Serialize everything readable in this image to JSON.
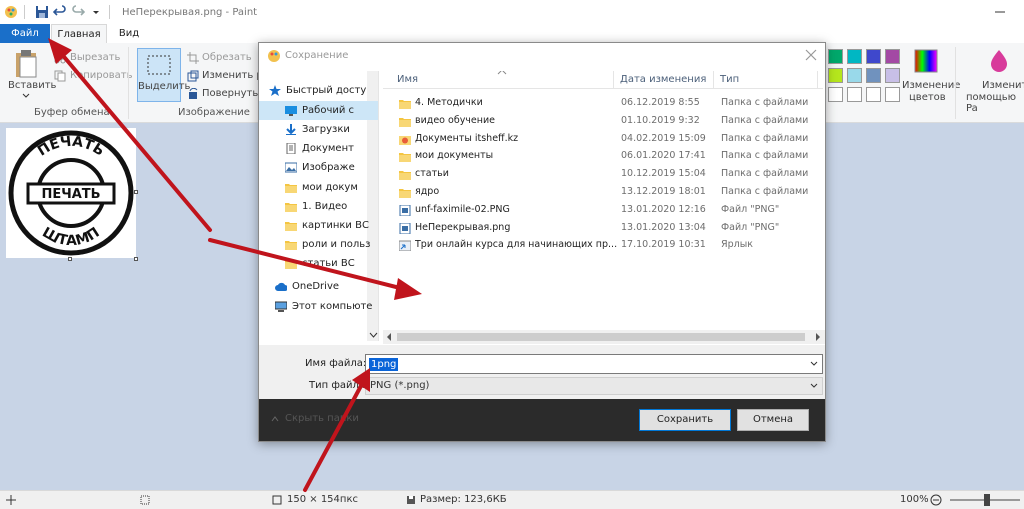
{
  "window": {
    "title": "НеПерекрывая.png - Paint"
  },
  "ribbon": {
    "tabs": [
      "Файл",
      "Главная",
      "Вид"
    ],
    "clipboard": {
      "paste": "Вставить",
      "cut": "Вырезать",
      "copy": "Копировать",
      "group": "Буфер обмена"
    },
    "image": {
      "select": "Выделить",
      "crop": "Обрезать",
      "resize": "Изменить ра",
      "rotate": "Повернуть",
      "group": "Изображение"
    },
    "colors": {
      "edit": "Изменение",
      "edit2": "цветов",
      "edit_with": "Изменить",
      "edit_with2": "помощью Pa"
    },
    "palette": [
      "#00a86b",
      "#00b7c3",
      "#3f48cc",
      "#a349a4",
      "#b5e61d",
      "#99d9ea",
      "#7092be",
      "#c8bfe7",
      "#ffffff",
      "#ffffff",
      "#ffffff",
      "#ffffff"
    ]
  },
  "canvas": {
    "stamp_text_top": "ПЕЧАТЬ",
    "stamp_text_center": "ПЕЧАТЬ",
    "stamp_text_bottom": "ШТАМП"
  },
  "status": {
    "size": "150 × 154пкс",
    "filesize": "Размер: 123,6КБ",
    "zoom": "100%"
  },
  "dialog": {
    "title": "Сохранение",
    "nav": [
      {
        "label": "Быстрый досту",
        "icon": "star-icon"
      },
      {
        "label": "Рабочий с",
        "icon": "desktop-icon",
        "selected": true
      },
      {
        "label": "Загрузки",
        "icon": "download-icon"
      },
      {
        "label": "Документ",
        "icon": "document-icon"
      },
      {
        "label": "Изображе",
        "icon": "picture-icon"
      },
      {
        "label": "мои докум",
        "icon": "folder-icon"
      },
      {
        "label": "1. Видео",
        "icon": "folder-icon"
      },
      {
        "label": "картинки ВС",
        "icon": "folder-icon"
      },
      {
        "label": "роли и польз",
        "icon": "folder-icon"
      },
      {
        "label": "статьи ВС",
        "icon": "folder-icon"
      },
      {
        "label": "OneDrive",
        "icon": "cloud-icon"
      },
      {
        "label": "Этот компьюте",
        "icon": "computer-icon"
      }
    ],
    "columns": {
      "name": "Имя",
      "date": "Дата изменения",
      "type": "Тип"
    },
    "files": [
      {
        "name": "4. Методички",
        "date": "06.12.2019 8:55",
        "type": "Папка с файлами",
        "icon": "folder-icon"
      },
      {
        "name": "видео обучение",
        "date": "01.10.2019 9:32",
        "type": "Папка с файлами",
        "icon": "folder-icon"
      },
      {
        "name": "Документы itsheff.kz",
        "date": "04.02.2019 15:09",
        "type": "Папка с файлами",
        "icon": "special-folder-icon"
      },
      {
        "name": "мои документы",
        "date": "06.01.2020 17:41",
        "type": "Папка с файлами",
        "icon": "folder-icon"
      },
      {
        "name": "статьи",
        "date": "10.12.2019 15:04",
        "type": "Папка с файлами",
        "icon": "folder-icon"
      },
      {
        "name": "ядро",
        "date": "13.12.2019 18:01",
        "type": "Папка с файлами",
        "icon": "folder-icon"
      },
      {
        "name": "unf-faximile-02.PNG",
        "date": "13.01.2020 12:16",
        "type": "Файл \"PNG\"",
        "icon": "image-file-icon"
      },
      {
        "name": "НеПерекрывая.png",
        "date": "13.01.2020 13:04",
        "type": "Файл \"PNG\"",
        "icon": "image-file-icon"
      },
      {
        "name": "Три онлайн курса для начинающих пр...",
        "date": "17.10.2019 10:31",
        "type": "Ярлык",
        "icon": "shortcut-icon"
      }
    ],
    "filename_label": "Имя файла:",
    "filename_value": "1png",
    "filetype_label": "Тип файла:",
    "filetype_value": "PNG (*.png)",
    "hide_folders": "Скрыть папки",
    "save": "Сохранить",
    "cancel": "Отмена"
  }
}
